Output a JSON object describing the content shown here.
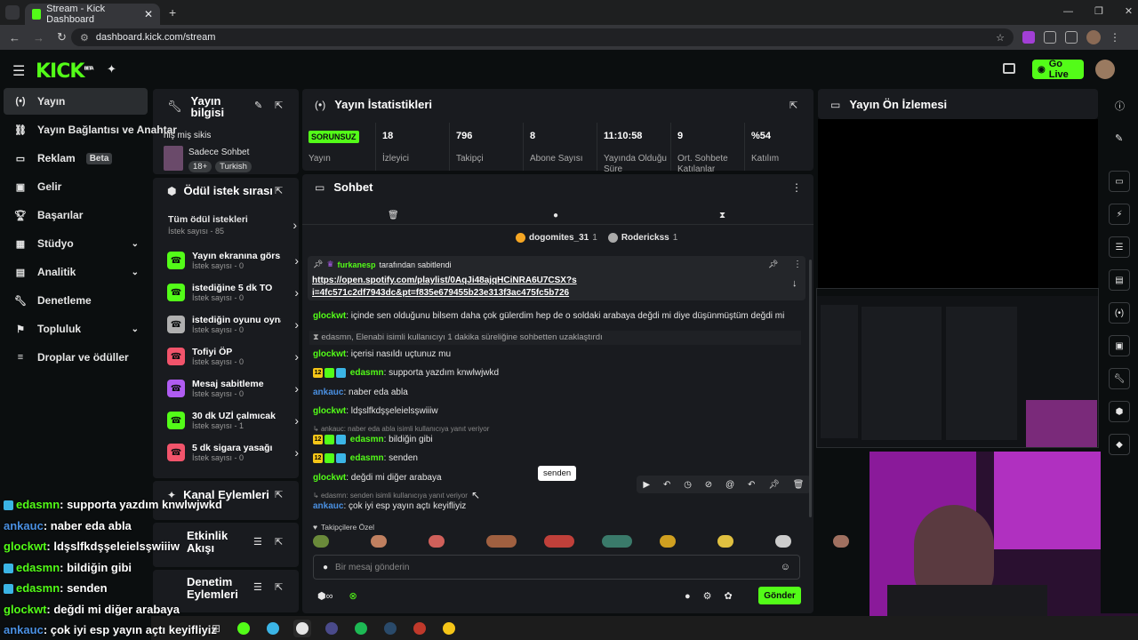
{
  "browser": {
    "tab_title": "Stream - Kick Dashboard",
    "url": "dashboard.kick.com/stream"
  },
  "header": {
    "logo": "KICK",
    "logo_sup": "BETA",
    "go_live": "Go Live"
  },
  "sidebar": {
    "items": [
      {
        "label": "Yayın"
      },
      {
        "label": "Yayın Bağlantısı ve Anahtar"
      },
      {
        "label": "Reklam",
        "badge": "Beta"
      },
      {
        "label": "Gelir"
      },
      {
        "label": "Başarılar"
      },
      {
        "label": "Stüdyo"
      },
      {
        "label": "Analitik"
      },
      {
        "label": "Denetleme"
      },
      {
        "label": "Topluluk"
      },
      {
        "label": "Droplar ve ödüller"
      }
    ]
  },
  "stream_info": {
    "title": "Yayın bilgisi",
    "stream_title": "niş miş sikis",
    "category": "Sadece Sohbet",
    "tags": [
      "18+",
      "Turkish"
    ]
  },
  "rewards": {
    "title": "Ödül istek sırası",
    "all_label": "Tüm ödül istekleri",
    "all_count": "İstek sayısı - 85",
    "items": [
      {
        "name": "Yayın ekranına görs...",
        "count": "İstek sayısı - 0",
        "color": "#53fc18"
      },
      {
        "name": "istediğine 5 dk TO",
        "count": "İstek sayısı - 0",
        "color": "#53fc18"
      },
      {
        "name": "istediğin oyunu oyna...",
        "count": "İstek sayısı - 0",
        "color": "#b0b0b0"
      },
      {
        "name": "Tofiyi ÖP",
        "count": "İstek sayısı - 0",
        "color": "#f2546b"
      },
      {
        "name": "Mesaj sabitleme",
        "count": "İstek sayısı - 0",
        "color": "#b05cf2"
      },
      {
        "name": "30 dk UZİ çalmıcak",
        "count": "İstek sayısı - 1",
        "color": "#53fc18"
      },
      {
        "name": "5 dk sigara yasağı",
        "count": "İstek sayısı - 0",
        "color": "#f2546b"
      }
    ]
  },
  "channel_actions": {
    "title": "Kanal Eylemleri"
  },
  "activity": {
    "title": "Etkinlik Akışı"
  },
  "mod_actions": {
    "title": "Denetim Eylemleri"
  },
  "stats": {
    "title": "Yayın İstatistikleri",
    "status": "SORUNSUZ",
    "status_label": "Yayın",
    "items": [
      {
        "value": "18",
        "label": "İzleyici"
      },
      {
        "value": "796",
        "label": "Takipçi"
      },
      {
        "value": "8",
        "label": "Abone Sayısı"
      },
      {
        "value": "11:10:58",
        "label": "Yayında Olduğu Süre"
      },
      {
        "value": "9",
        "label": "Ort. Sohbete Katılanlar"
      },
      {
        "value": "%54",
        "label": "Katılım"
      }
    ]
  },
  "chat": {
    "title": "Sohbet",
    "top_gifters": [
      {
        "name": "dogomites_31",
        "count": "1"
      },
      {
        "name": "Roderickss",
        "count": "1"
      }
    ],
    "pinned": {
      "by": "furkanesp",
      "by_suffix": "tarafından sabitlendi",
      "link": "https://open.spotify.com/playlist/0AqJi48ajqHCiNRA6U7CSX?si=4fc571c2df7943dc&pt=f835e679455b23e313f3ac475fc5b726"
    },
    "messages": [
      {
        "user": "glockwt",
        "text": ": içinde sen olduğunu bilsem daha çok gülerdim hep de o soldaki arabaya değdi mi diye düşünmüştüm değdi mi",
        "color": "#53fc18"
      },
      {
        "system": "edasmn, Elenabi isimli kullanıcıyı 1 dakika süreliğine sohbetten uzaklaştırdı"
      },
      {
        "user": "glockwt",
        "text": ": içerisi nasıldı uçtunuz mu",
        "color": "#53fc18"
      },
      {
        "user": "edasmn",
        "text": ": supporta yazdım knwlwjwkd",
        "color": "#53fc18",
        "badges": true
      },
      {
        "user": "ankauc",
        "text": ": naber eda abla",
        "color": "#4a90e2"
      },
      {
        "user": "glockwt",
        "text": ": ldşslfkdşşeleielsşwiiiw",
        "color": "#53fc18"
      },
      {
        "reply": "ankauc: naber eda abla isimli kullanıcıya yanıt veriyor"
      },
      {
        "user": "edasmn",
        "text": ": bildiğin gibi",
        "color": "#53fc18",
        "badges": true
      },
      {
        "user": "edasmn",
        "text": ": senden",
        "color": "#53fc18",
        "badges": true
      },
      {
        "user": "glockwt",
        "text": ": değdi mi diğer arabaya",
        "color": "#53fc18"
      },
      {
        "reply": "edasmn: senden isimli kullanıcıya yanıt veriyor"
      },
      {
        "user": "ankauc",
        "text": ": çok iyi esp yayın açtı keyifliyiz",
        "color": "#4a90e2"
      }
    ],
    "tooltip": "senden",
    "emote_label": "Takipçilere Özel",
    "placeholder": "Bir mesaj gönderin",
    "send": "Gönder"
  },
  "preview": {
    "title": "Yayın Ön İzlemesi"
  },
  "overlay_chat": [
    {
      "user": "edasmn",
      "text": ": supporta yazdım knwlwjwkd",
      "color": "#53fc18"
    },
    {
      "user": "ankauc",
      "text": ": naber eda abla",
      "color": "#4a90e2"
    },
    {
      "user": "glockwt",
      "text": ": ldşslfkdşşeleielsşwiiiw",
      "color": "#53fc18"
    },
    {
      "user": "edasmn",
      "text": ": bildiğin gibi",
      "color": "#53fc18"
    },
    {
      "user": "edasmn",
      "text": ": senden",
      "color": "#53fc18"
    },
    {
      "user": "glockwt",
      "text": ": değdi mi diğer arabaya",
      "color": "#53fc18"
    },
    {
      "user": "ankauc",
      "text": ": çok iyi esp yayın açtı keyifliyiz",
      "color": "#4a90e2"
    }
  ]
}
